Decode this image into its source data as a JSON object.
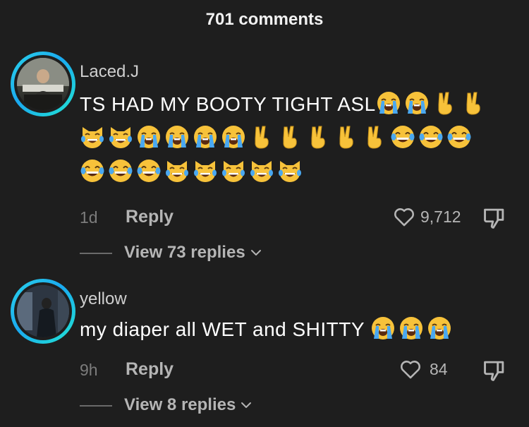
{
  "header": {
    "title": "701 comments"
  },
  "comments": [
    {
      "username": "Laced.J",
      "text": "TS HAD MY BOOTY TIGHT ASL",
      "emoji_rows": [
        [
          "loudly-crying-face",
          "loudly-crying-face",
          "victory-hand",
          "victory-hand"
        ],
        [
          "cat-tears-of-joy",
          "cat-tears-of-joy",
          "loudly-crying-face",
          "loudly-crying-face",
          "loudly-crying-face",
          "loudly-crying-face",
          "victory-hand",
          "victory-hand",
          "victory-hand",
          "victory-hand",
          "victory-hand",
          "face-tears-of-joy",
          "face-tears-of-joy",
          "face-tears-of-joy"
        ],
        [
          "face-tears-of-joy",
          "face-tears-of-joy",
          "face-tears-of-joy",
          "cat-tears-of-joy",
          "cat-tears-of-joy",
          "cat-tears-of-joy",
          "cat-tears-of-joy",
          "cat-tears-of-joy"
        ]
      ],
      "time": "1d",
      "reply_label": "Reply",
      "likes": "9,712",
      "view_replies": "View 73 replies"
    },
    {
      "username": "yellow",
      "text": "my diaper all WET and SHITTY",
      "emoji_rows": [
        [
          "loudly-crying-face",
          "loudly-crying-face",
          "loudly-crying-face"
        ]
      ],
      "time": "9h",
      "reply_label": "Reply",
      "likes": "84",
      "view_replies": "View 8 replies"
    }
  ],
  "colors": {
    "background": "#1e1e1e",
    "ring_gradient": "#2bd4e8",
    "secondary_text": "#b5b5b5",
    "muted_text": "#7c7c7c"
  },
  "icons": [
    "heart-outline-icon",
    "thumbs-down-icon",
    "chevron-down-icon"
  ]
}
